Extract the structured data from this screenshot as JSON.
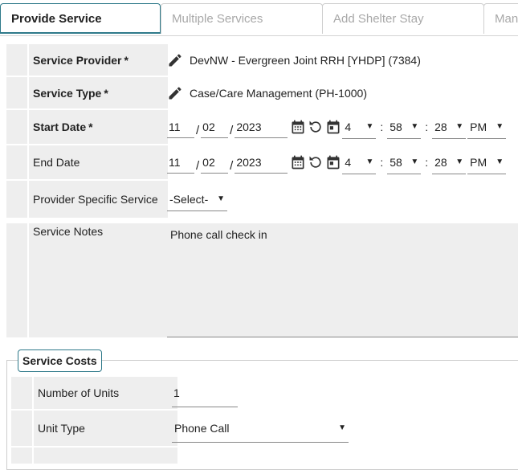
{
  "tabs": [
    {
      "label": "Provide Service"
    },
    {
      "label": "Multiple Services"
    },
    {
      "label": "Add Shelter Stay"
    },
    {
      "label": "Man"
    }
  ],
  "form": {
    "service_provider": {
      "label": "Service Provider",
      "required": "*",
      "value": "DevNW - Evergreen Joint RRH [YHDP] (7384)"
    },
    "service_type": {
      "label": "Service Type",
      "required": "*",
      "value": "Case/Care Management (PH-1000)"
    },
    "start_date": {
      "label": "Start Date",
      "required": "*",
      "month": "11",
      "day": "02",
      "year": "2023",
      "hour": "4",
      "minute": "58",
      "second": "28",
      "ampm": "PM"
    },
    "end_date": {
      "label": "End Date",
      "month": "11",
      "day": "02",
      "year": "2023",
      "hour": "4",
      "minute": "58",
      "second": "28",
      "ampm": "PM"
    },
    "provider_specific": {
      "label": "Provider Specific Service",
      "value": "-Select-"
    },
    "service_notes": {
      "label": "Service Notes",
      "value": "Phone call check in"
    }
  },
  "costs": {
    "legend": "Service Costs",
    "units": {
      "label": "Number of Units",
      "value": "1"
    },
    "unit_type": {
      "label": "Unit Type",
      "value": "Phone Call"
    }
  },
  "colors": {
    "accent": "#2f7a8a",
    "label_bg": "#eeeeee",
    "icon": "#333333"
  },
  "icons": [
    "pencil-icon",
    "calendar-icon",
    "undo-icon",
    "calendar-today-icon",
    "chevron-down-icon"
  ]
}
